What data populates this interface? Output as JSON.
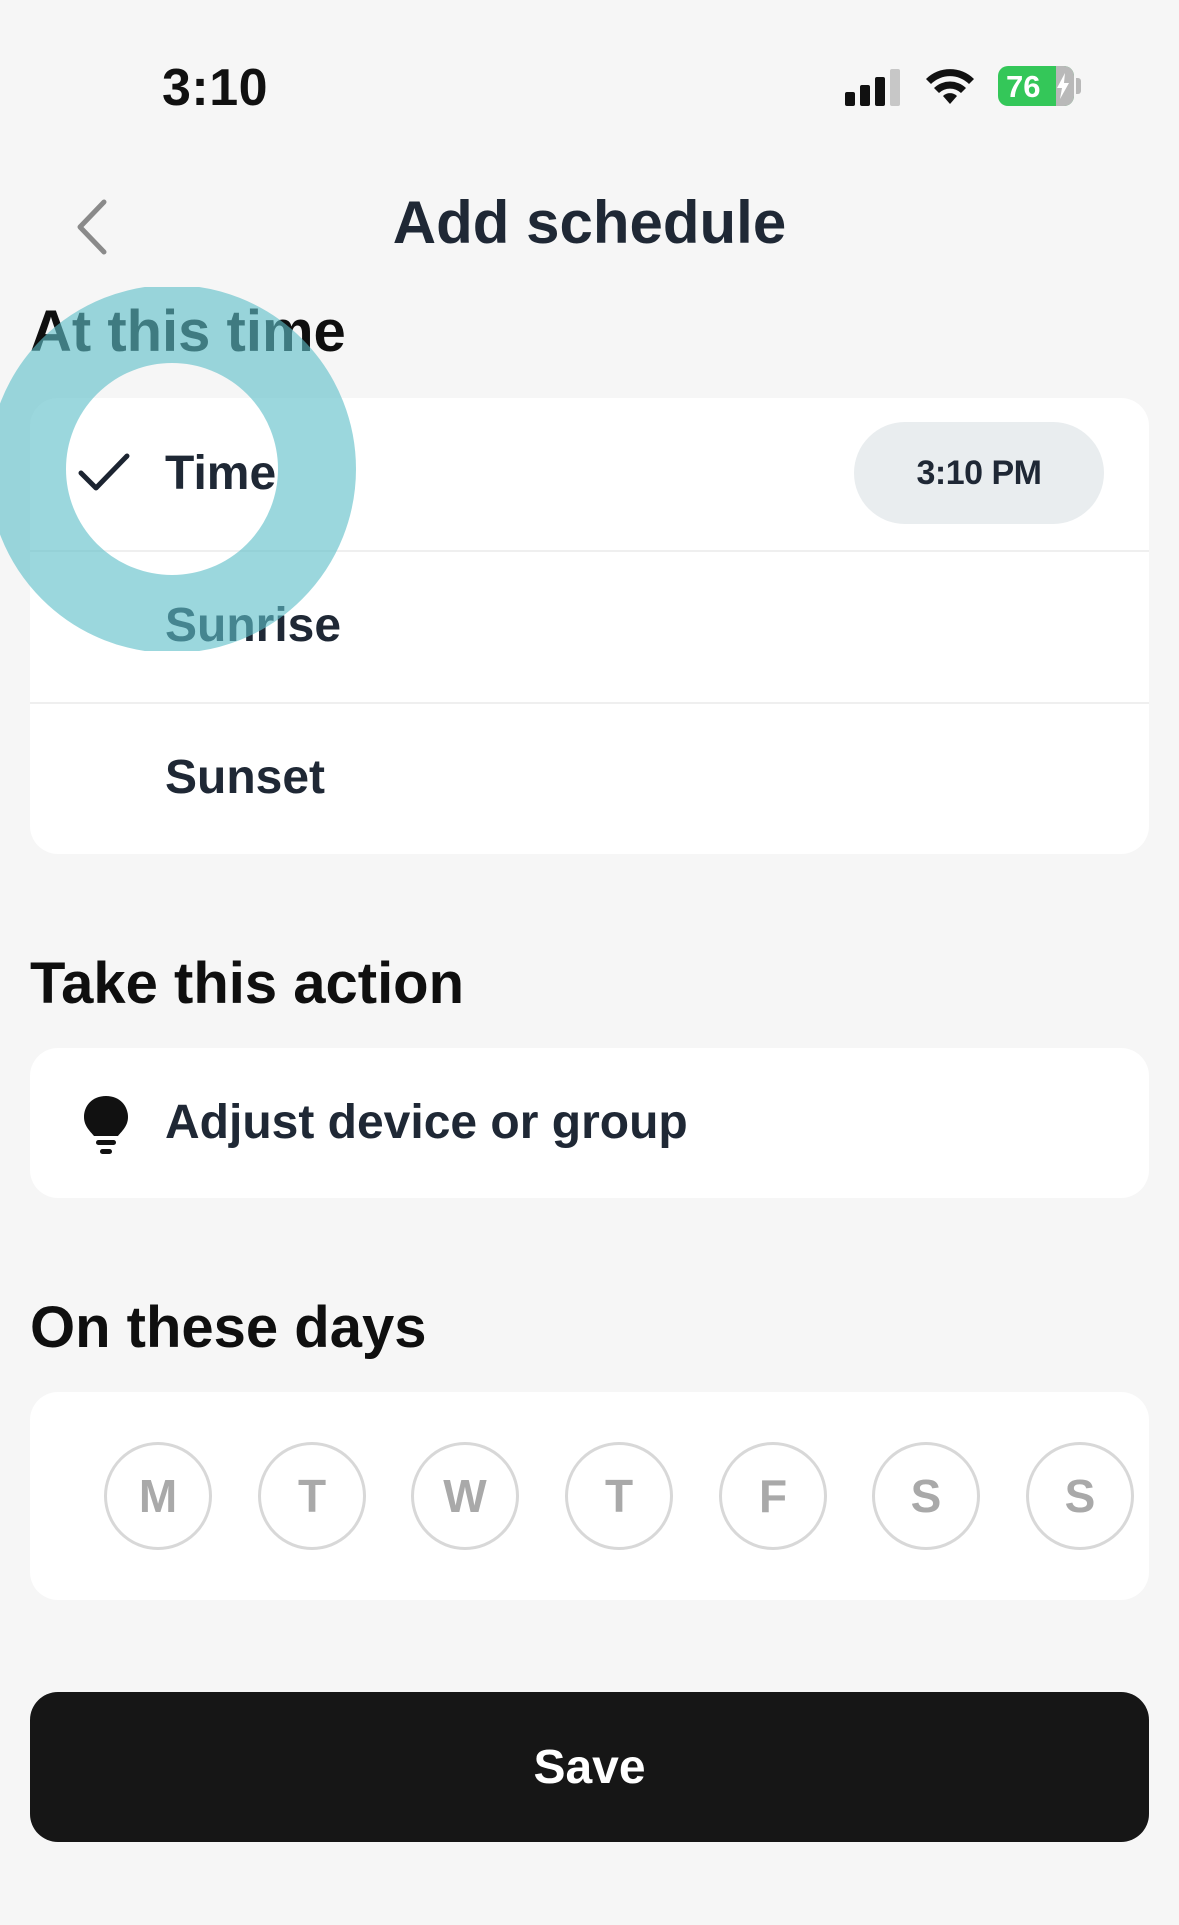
{
  "status_bar": {
    "time": "3:10",
    "battery": "76"
  },
  "header": {
    "title": "Add schedule",
    "back_icon": "chevron-left-icon"
  },
  "time_section": {
    "title": "At this time",
    "options": [
      {
        "label": "Time",
        "selected": true,
        "value": "3:10 PM"
      },
      {
        "label": "Sunrise",
        "selected": false
      },
      {
        "label": "Sunset",
        "selected": false
      }
    ]
  },
  "action_section": {
    "title": "Take this action",
    "item_label": "Adjust device or group",
    "item_icon": "lightbulb-icon"
  },
  "days_section": {
    "title": "On these days",
    "days": [
      "M",
      "T",
      "W",
      "T",
      "F",
      "S",
      "S"
    ]
  },
  "save_label": "Save",
  "colors": {
    "background": "#f6f6f6",
    "card": "#ffffff",
    "primary_button": "#161616",
    "time_pill": "#e9edef",
    "battery": "#34c759",
    "touch_indicator": "#5ebec8"
  }
}
